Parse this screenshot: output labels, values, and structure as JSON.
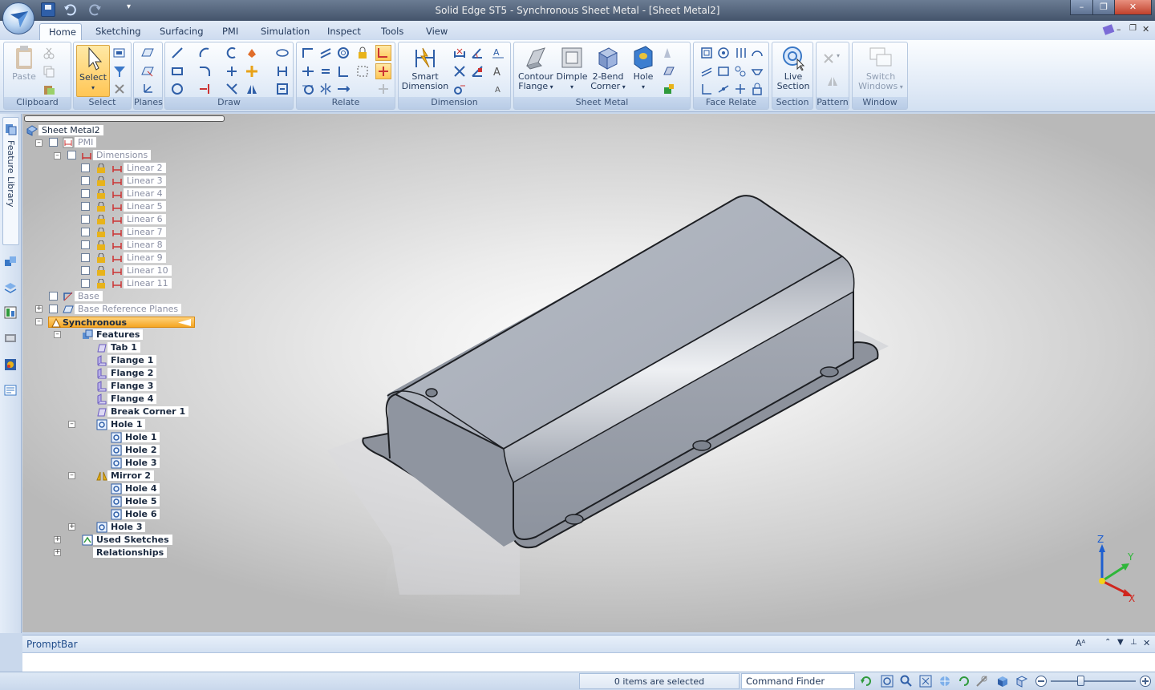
{
  "window": {
    "title": "Solid Edge ST5 - Synchronous Sheet Metal - [Sheet Metal2]",
    "controls": [
      "–",
      "❐",
      "✕"
    ]
  },
  "ribbon_tabs": [
    "Home",
    "Sketching",
    "Surfacing",
    "PMI",
    "Simulation",
    "Inspect",
    "Tools",
    "View"
  ],
  "groups": {
    "clipboard": {
      "label": "Clipboard",
      "paste": "Paste"
    },
    "select": {
      "label": "Select",
      "select": "Select"
    },
    "planes": {
      "label": "Planes"
    },
    "draw": {
      "label": "Draw"
    },
    "relate": {
      "label": "Relate"
    },
    "dimension": {
      "label": "Dimension",
      "smart_dimension": "Smart Dimension"
    },
    "sheet_metal": {
      "label": "Sheet Metal",
      "contour_flange": "Contour Flange",
      "dimple": "Dimple",
      "two_bend_corner": "2-Bend Corner",
      "hole": "Hole"
    },
    "face_relate": {
      "label": "Face Relate"
    },
    "section": {
      "label": "Section",
      "live_section": "Live Section"
    },
    "pattern": {
      "label": "Pattern"
    },
    "window": {
      "label": "Window",
      "switch_windows": "Switch Windows"
    }
  },
  "left_bar": {
    "feature_library": "Feature Library"
  },
  "tree": {
    "root": "Sheet Metal2",
    "pmi": "PMI",
    "dimensions": "Dimensions",
    "linears": [
      "Linear 2",
      "Linear 3",
      "Linear 4",
      "Linear 5",
      "Linear 6",
      "Linear 7",
      "Linear 8",
      "Linear 9",
      "Linear 10",
      "Linear 11"
    ],
    "base": "Base",
    "base_ref_planes": "Base Reference Planes",
    "synchronous": "Synchronous",
    "features": "Features",
    "tab1": "Tab 1",
    "flange1": "Flange 1",
    "flange2": "Flange 2",
    "flange3": "Flange 3",
    "flange4": "Flange 4",
    "break_corner1": "Break Corner 1",
    "hole1_group": "Hole 1",
    "hole1": "Hole 1",
    "hole2": "Hole 2",
    "hole3": "Hole 3",
    "mirror2": "Mirror 2",
    "hole4": "Hole 4",
    "hole5": "Hole 5",
    "hole6": "Hole 6",
    "hole3_group": "Hole 3",
    "used_sketches": "Used Sketches",
    "relationships": "Relationships"
  },
  "triad": {
    "z": "Z",
    "y": "Y",
    "x": "X"
  },
  "promptbar": {
    "title": "PromptBar"
  },
  "status": {
    "selection": "0 items are selected",
    "command_finder": "Command Finder"
  },
  "colors": {
    "accent": "#f5a623",
    "ribbon": "#dfe9f6",
    "model": "#9ea3ad"
  }
}
